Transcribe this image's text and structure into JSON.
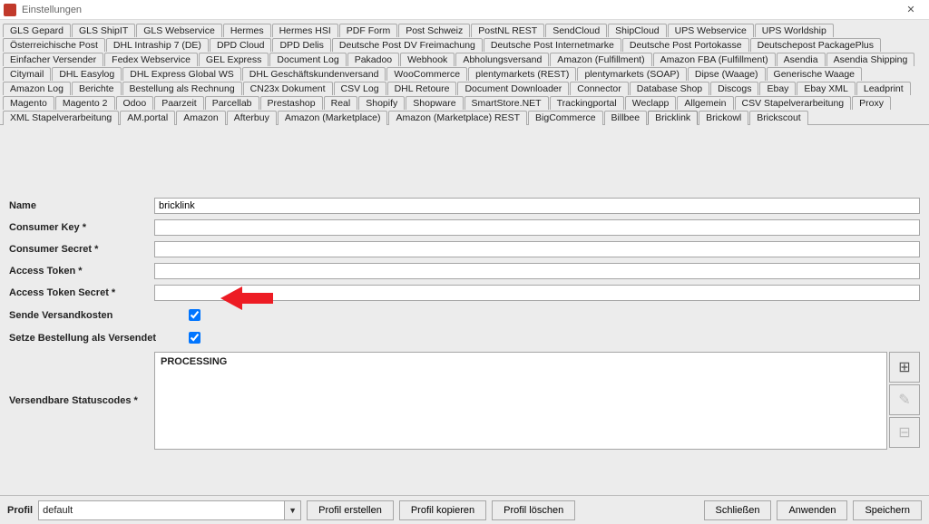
{
  "window": {
    "title": "Einstellungen"
  },
  "tabs_row1": [
    "GLS Gepard",
    "GLS ShipIT",
    "GLS Webservice",
    "Hermes",
    "Hermes HSI",
    "PDF Form",
    "Post Schweiz",
    "PostNL REST",
    "SendCloud",
    "ShipCloud",
    "UPS Webservice",
    "UPS Worldship",
    "Österreichische Post"
  ],
  "tabs_row2": [
    "DHL Intraship 7 (DE)",
    "DPD Cloud",
    "DPD Delis",
    "Deutsche Post DV Freimachung",
    "Deutsche Post Internetmarke",
    "Deutsche Post Portokasse",
    "Deutschepost PackagePlus",
    "Einfacher Versender",
    "Fedex Webservice",
    "GEL Express"
  ],
  "tabs_row3": [
    "Document Log",
    "Pakadoo",
    "Webhook",
    "Abholungsversand",
    "Amazon (Fulfillment)",
    "Amazon FBA (Fulfillment)",
    "Asendia",
    "Asendia Shipping",
    "Citymail",
    "DHL Easylog",
    "DHL Express Global WS",
    "DHL Geschäftskundenversand"
  ],
  "tabs_row4": [
    "WooCommerce",
    "plentymarkets (REST)",
    "plentymarkets (SOAP)",
    "Dipse (Waage)",
    "Generische Waage",
    "Amazon Log",
    "Berichte",
    "Bestellung als Rechnung",
    "CN23x Dokument",
    "CSV Log",
    "DHL Retoure",
    "Document Downloader"
  ],
  "tabs_row5": [
    "Connector",
    "Database Shop",
    "Discogs",
    "Ebay",
    "Ebay XML",
    "Leadprint",
    "Magento",
    "Magento 2",
    "Odoo",
    "Paarzeit",
    "Parcellab",
    "Prestashop",
    "Real",
    "Shopify",
    "Shopware",
    "SmartStore.NET",
    "Trackingportal",
    "Weclapp"
  ],
  "tabs_row6": [
    "Allgemein",
    "CSV Stapelverarbeitung",
    "Proxy",
    "XML Stapelverarbeitung",
    "AM.portal",
    "Amazon",
    "Afterbuy",
    "Amazon (Marketplace)",
    "Amazon (Marketplace) REST",
    "BigCommerce",
    "Billbee",
    "Bricklink",
    "Brickowl",
    "Brickscout"
  ],
  "active_tab": "Bricklink",
  "form": {
    "name_label": "Name",
    "name_value": "bricklink",
    "consumer_key_label": "Consumer Key *",
    "consumer_key_value": "",
    "consumer_secret_label": "Consumer Secret *",
    "consumer_secret_value": "",
    "access_token_label": "Access Token *",
    "access_token_value": "",
    "access_token_secret_label": "Access Token Secret *",
    "access_token_secret_value": "",
    "send_shipping_label": "Sende Versandkosten",
    "send_shipping_checked": true,
    "set_shipped_label": "Setze Bestellung als Versendet",
    "set_shipped_checked": true,
    "status_codes_label": "Versendbare Statuscodes *",
    "status_codes_value": "PROCESSING"
  },
  "footer": {
    "profile_label": "Profil",
    "profile_value": "default",
    "create": "Profil erstellen",
    "copy": "Profil kopieren",
    "delete": "Profil löschen",
    "close": "Schließen",
    "apply": "Anwenden",
    "save": "Speichern"
  }
}
